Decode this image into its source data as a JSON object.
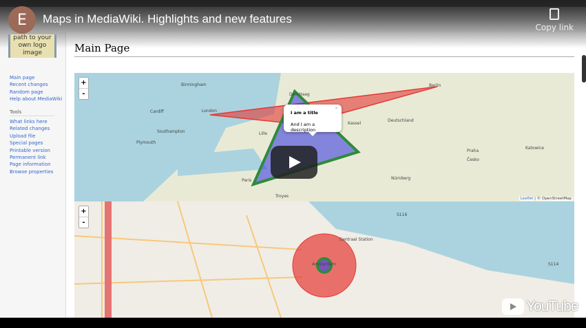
{
  "video": {
    "channel_initial": "E",
    "title": "Maps in MediaWiki. Highlights and new features",
    "copy_link": "Copy link",
    "brand": "YouTube"
  },
  "logo_text": "path to your own logo image",
  "page_title": "Main Page",
  "sidebar": {
    "nav": [
      "Main page",
      "Recent changes",
      "Random page",
      "Help about MediaWiki"
    ],
    "tools_heading": "Tools",
    "tools": [
      "What links here",
      "Related changes",
      "Upload file",
      "Special pages",
      "Printable version",
      "Permanent link",
      "Page information",
      "Browse properties"
    ]
  },
  "map1": {
    "zoom_in": "+",
    "zoom_out": "-",
    "popup": {
      "title": "I am a title",
      "description": "And I am a description",
      "close": "×"
    },
    "labels": [
      "Birmingham",
      "London",
      "Cardiff",
      "Southampton",
      "Plymouth",
      "Den Haag",
      "Lille",
      "Paris",
      "Troyes",
      "Deutschland",
      "Kassel",
      "Berlin",
      "Česko",
      "Katowice",
      "Praha",
      "Nürnberg"
    ],
    "attribution": {
      "leaflet": "Leaflet",
      "osm": "| © OpenStreetMap"
    },
    "colors": {
      "triangle_red": "#e53935",
      "triangle_blue": "#3f3fdd",
      "outline_green": "#2e8b3a"
    }
  },
  "map2": {
    "zoom_in": "+",
    "zoom_out": "-",
    "labels": [
      "Amsterdam",
      "S116",
      "S114",
      "Centraal Station"
    ],
    "colors": {
      "circle_red": "#e53935",
      "circle_green": "#2e8b3a"
    }
  }
}
